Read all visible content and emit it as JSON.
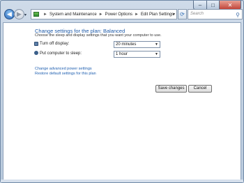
{
  "window": {
    "caption": {
      "minimize": "–",
      "maximize": "□",
      "close": "✕"
    }
  },
  "nav": {
    "back_glyph": "◀",
    "forward_glyph": "▶",
    "dropdown_glyph": "▾"
  },
  "address": {
    "separator": "►",
    "crumbs": [
      "System and Maintenance",
      "Power Options",
      "Edit Plan Settings"
    ],
    "dropdown_glyph": "▾"
  },
  "refresh_glyph": "⟳",
  "search": {
    "placeholder": "Search",
    "icon_glyph": "⚲"
  },
  "page": {
    "title": "Change settings for the plan: Balanced",
    "subtitle": "Choose the sleep and display settings that you want your computer to use."
  },
  "settings": {
    "display": {
      "label": "Turn off display:",
      "value": "20 minutes"
    },
    "sleep": {
      "label": "Put computer to sleep:",
      "value": "1 hour"
    },
    "caret": "▼"
  },
  "links": {
    "advanced": "Change advanced power settings",
    "restore": "Restore default settings for this plan"
  },
  "buttons": {
    "save": "Save changes",
    "cancel": "Cancel"
  }
}
